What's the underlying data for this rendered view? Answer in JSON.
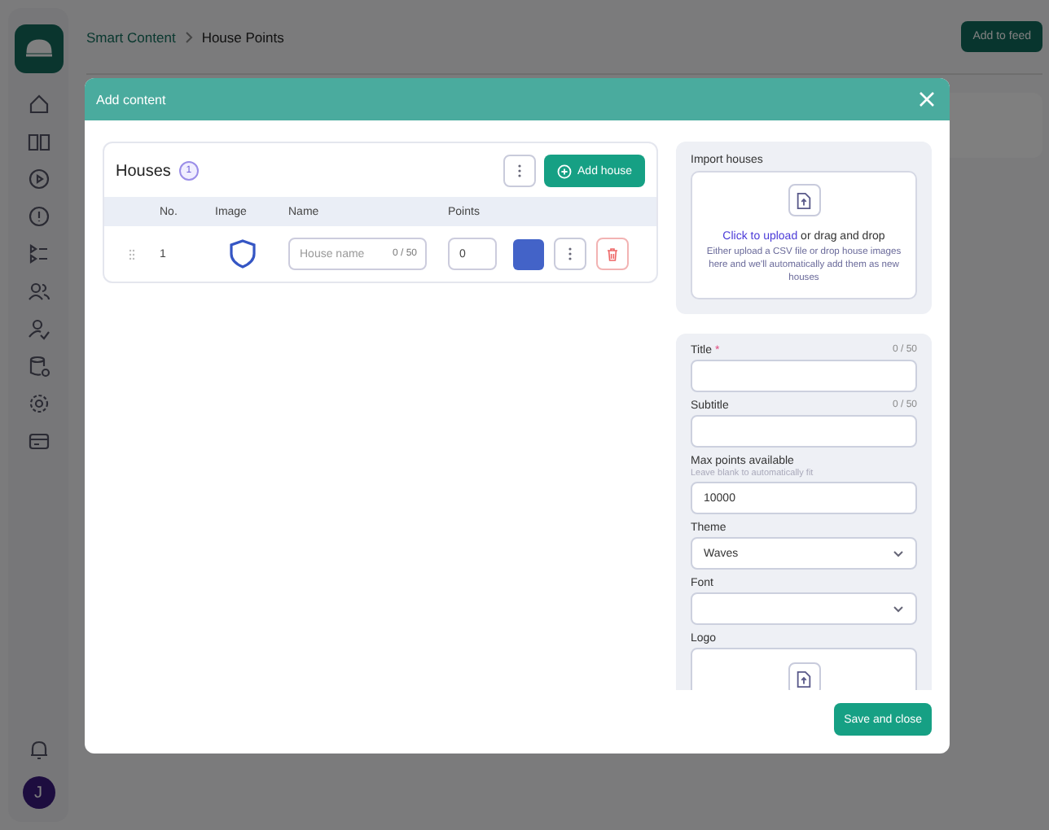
{
  "breadcrumb": [
    "Smart Content",
    "House Points"
  ],
  "header_button": "Add to feed",
  "avatar_letter": "J",
  "modal": {
    "title": "Add content",
    "houses": {
      "title": "Houses",
      "count": "1",
      "add_button": "Add house",
      "columns": [
        "No.",
        "Image",
        "Name",
        "Points"
      ],
      "rows": [
        {
          "number": "1",
          "name_placeholder": "House name",
          "name_counter": "0 / 50",
          "points": "0",
          "color": "#4363c8"
        }
      ]
    },
    "import": {
      "label": "Import houses",
      "link": "Click to upload",
      "link_rest": "or drag and drop",
      "hint": "Either upload a CSV file or drop house images here and we'll automatically add them as new houses"
    },
    "fields": [
      {
        "kind": "text",
        "label": "Title",
        "required_mark": "*",
        "counter": "0 / 50"
      },
      {
        "kind": "text",
        "label": "Subtitle",
        "counter": "0 / 50"
      },
      {
        "kind": "text",
        "label": "Max points available",
        "hint": "Leave blank to automatically fit",
        "value": "10000"
      },
      {
        "kind": "select",
        "label": "Theme",
        "value": "Waves"
      },
      {
        "kind": "select",
        "label": "Font"
      },
      {
        "kind": "upload",
        "label": "Logo"
      }
    ],
    "save_button": "Save and close"
  }
}
